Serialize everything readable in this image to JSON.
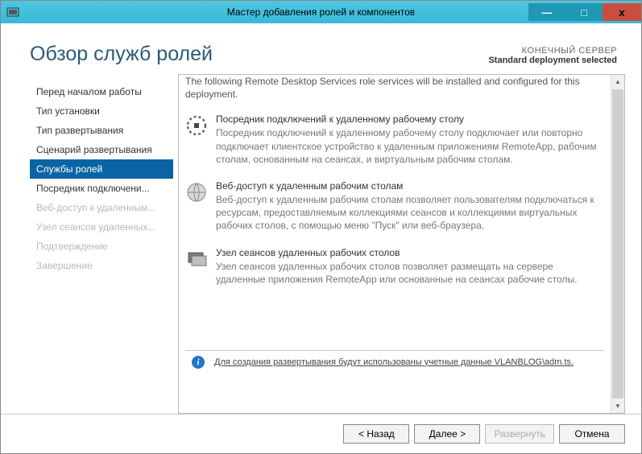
{
  "window": {
    "title": "Мастер добавления ролей и компонентов"
  },
  "header": {
    "page_title": "Обзор служб ролей",
    "target_label": "КОНЕЧНЫЙ СЕРВЕР",
    "target_value": "Standard deployment selected"
  },
  "sidebar": {
    "items": [
      {
        "label": "Перед началом работы",
        "state": "normal"
      },
      {
        "label": "Тип установки",
        "state": "normal"
      },
      {
        "label": "Тип развертывания",
        "state": "normal"
      },
      {
        "label": "Сценарий развертывания",
        "state": "normal"
      },
      {
        "label": "Службы ролей",
        "state": "active"
      },
      {
        "label": "Посредник подключени...",
        "state": "normal"
      },
      {
        "label": "Веб-доступ к удаленным...",
        "state": "disabled"
      },
      {
        "label": "Узел сеансов удаленных...",
        "state": "disabled"
      },
      {
        "label": "Подтверждение",
        "state": "disabled"
      },
      {
        "label": "Завершение",
        "state": "disabled"
      }
    ]
  },
  "content": {
    "intro": "The following Remote Desktop Services role services will be installed and configured for this deployment.",
    "roles": [
      {
        "icon": "rd-broker-icon",
        "title": "Посредник подключений к удаленному рабочему столу",
        "desc": "Посредник подключений к удаленному рабочему столу подключает или повторно подключает клиентское устройство к удаленным приложениям RemoteApp, рабочим столам, основанным на сеансах, и виртуальным рабочим столам."
      },
      {
        "icon": "rd-web-icon",
        "title": "Веб-доступ к удаленным рабочим столам",
        "desc": "Веб-доступ к удаленным рабочим столам позволяет пользователям подключаться к ресурсам, предоставляемым коллекциями сеансов и коллекциями виртуальных рабочих столов, с помощью меню \"Пуск\" или веб-браузера."
      },
      {
        "icon": "rd-session-icon",
        "title": "Узел сеансов удаленных рабочих столов",
        "desc": "Узел сеансов удаленных рабочих столов позволяет размещать на сервере удаленные приложения RemoteApp или основанные на сеансах рабочие столы."
      }
    ],
    "info_note": "Для создания развертывания будут использованы учетные данные VLANBLOG\\adm.ts."
  },
  "footer": {
    "back": "< Назад",
    "next": "Далее >",
    "deploy": "Развернуть",
    "cancel": "Отмена"
  }
}
